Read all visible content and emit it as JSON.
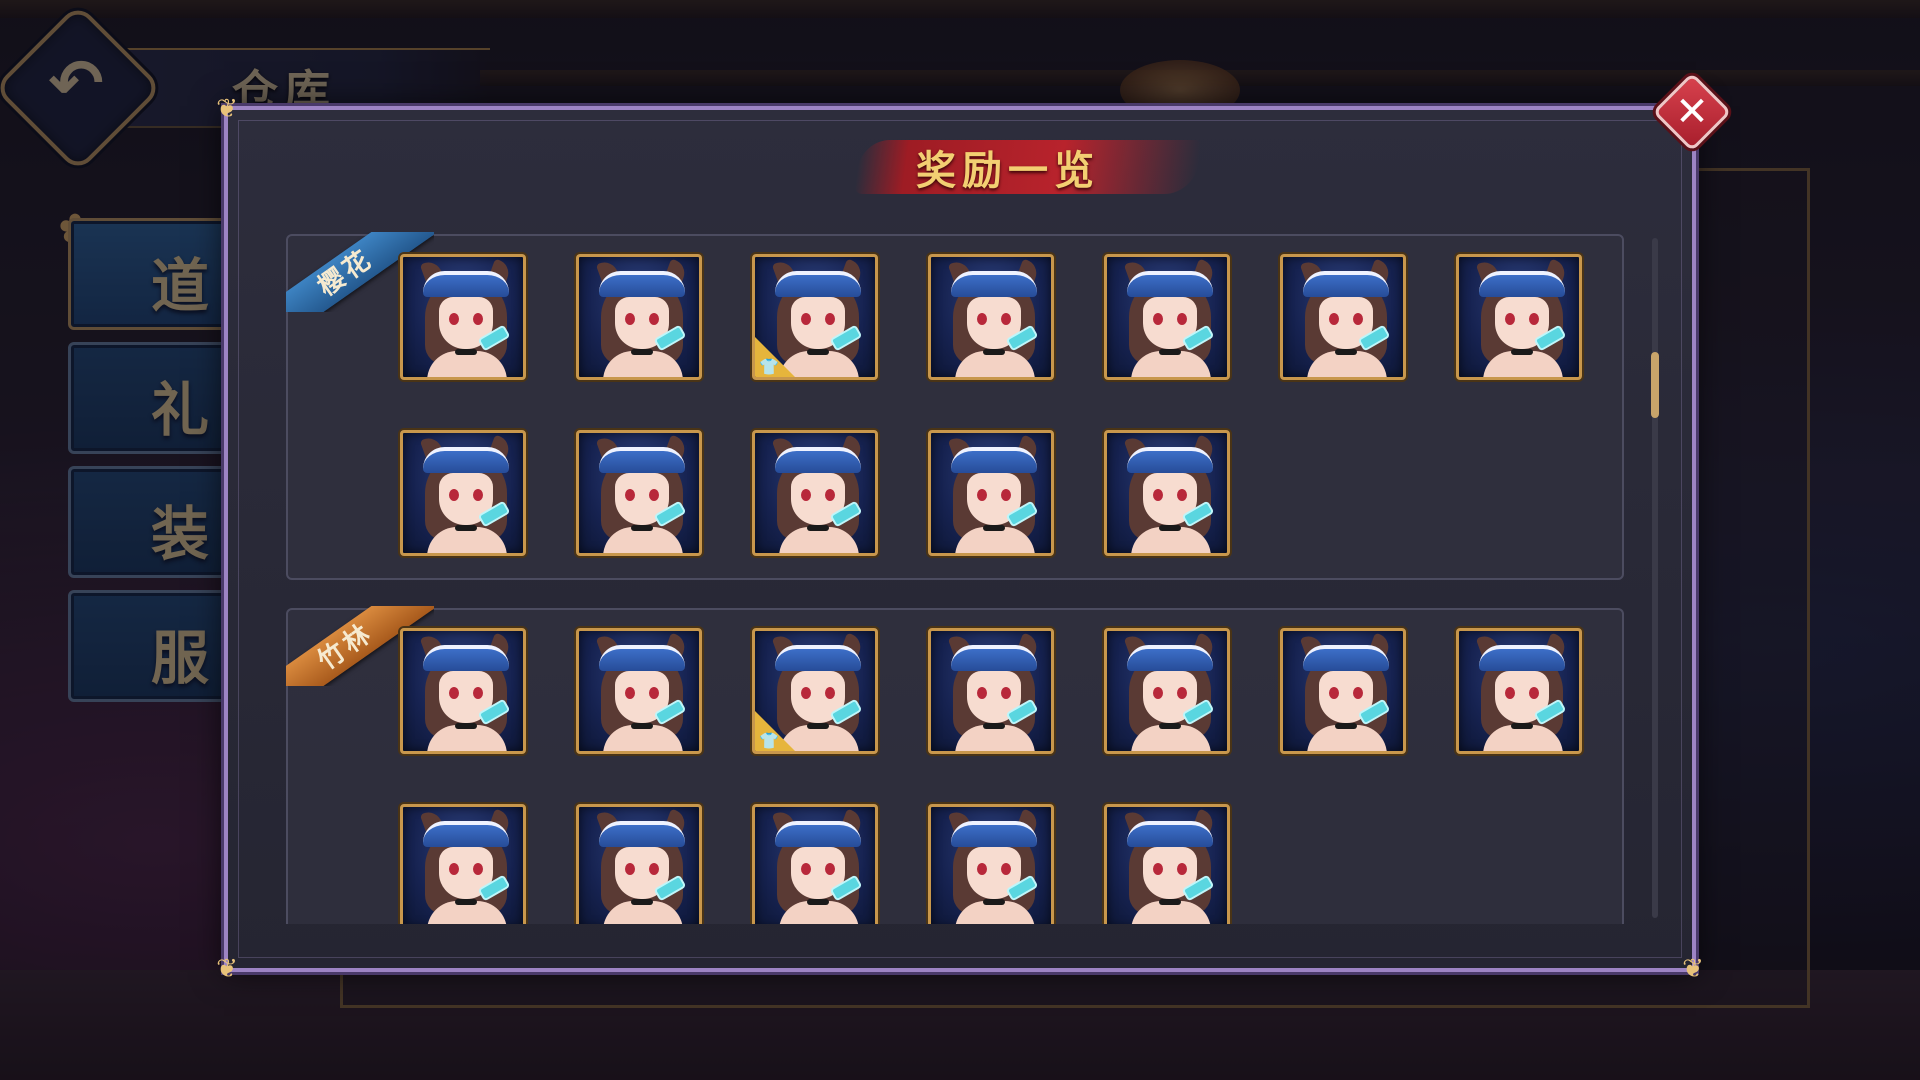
{
  "header": {
    "title": "仓库",
    "back_icon": "back-arrow-icon"
  },
  "sidebar": {
    "items": [
      {
        "label": "道具"
      },
      {
        "label": "礼物"
      },
      {
        "label": "装扮"
      },
      {
        "label": "服饰"
      }
    ]
  },
  "modal": {
    "title": "奖励一览",
    "close_icon": "close-icon",
    "groups": [
      {
        "label": "樱花",
        "color": "#3d83c2",
        "item_count": 12
      },
      {
        "label": "竹林",
        "color": "#d98a3e",
        "item_count": 12
      }
    ]
  },
  "colors": {
    "accent_gold": "#c8974c",
    "modal_border": "#9d84c4",
    "close_red": "#c02a38"
  }
}
